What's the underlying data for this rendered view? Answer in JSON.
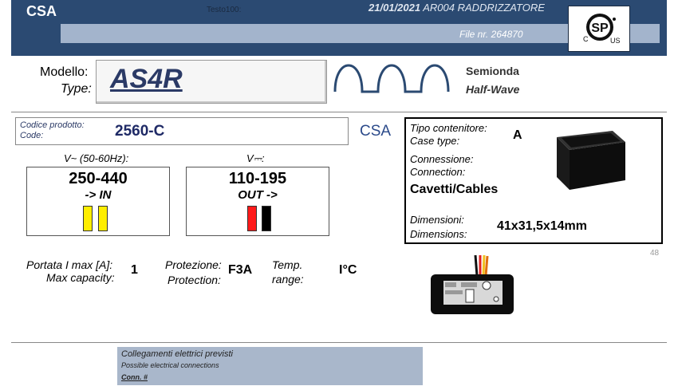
{
  "header": {
    "brand": "CSA",
    "testo": "Testo100:",
    "date": "21/01/2021",
    "doc_title": "AR004 RADDRIZZATORE",
    "file_number": "File nr. 264870",
    "cert_logo": {
      "icon": "csa-us-mark",
      "c_label": "C",
      "us_label": "US"
    }
  },
  "model": {
    "label_it": "Modello:",
    "label_en": "Type:",
    "value": "AS4R",
    "waveform_icon": "half-wave-icon",
    "wave_label_it": "Semionda",
    "wave_label_en": "Half-Wave"
  },
  "code": {
    "label_it": "Codice prodotto:",
    "label_en": "Code:",
    "value": "2560-C",
    "cert": "CSA"
  },
  "voltage": {
    "in_label": "V~ (50-60Hz):",
    "in_value": "250-440",
    "in_dir": "-> IN",
    "in_wire_colors": [
      "#ffee00",
      "#ffee00"
    ],
    "out_label": "V⎓:",
    "out_value": "110-195",
    "out_dir": "OUT ->",
    "out_wire_colors": [
      "#ff1a1a",
      "#000000"
    ]
  },
  "case": {
    "type_label_it": "Tipo contenitore:",
    "type_label_en": "Case type:",
    "type_value": "A",
    "conn_label_it": "Connessione:",
    "conn_label_en": "Connection:",
    "conn_value": "Cavetti/Cables",
    "dim_label_it": "Dimensioni:",
    "dim_label_en": "Dimensions:",
    "dim_value": "41x31,5x14mm",
    "image_icon": "case-box-image"
  },
  "page_number": "48",
  "specs": {
    "max_label_it": "Portata I max [A]:",
    "max_label_en": "Max capacity:",
    "max_value": "1",
    "prot_label_it": "Protezione:",
    "prot_label_en": "Protection:",
    "prot_value": "F3A",
    "temp_label_1": "Temp.",
    "temp_label_2": "range:",
    "temp_value": "I°C",
    "product_image": "rectifier-module-image"
  },
  "connections": {
    "title_it": "Collegamenti elettrici previsti",
    "title_en": "Possible electrical connections",
    "conn_label": "Conn. #"
  }
}
